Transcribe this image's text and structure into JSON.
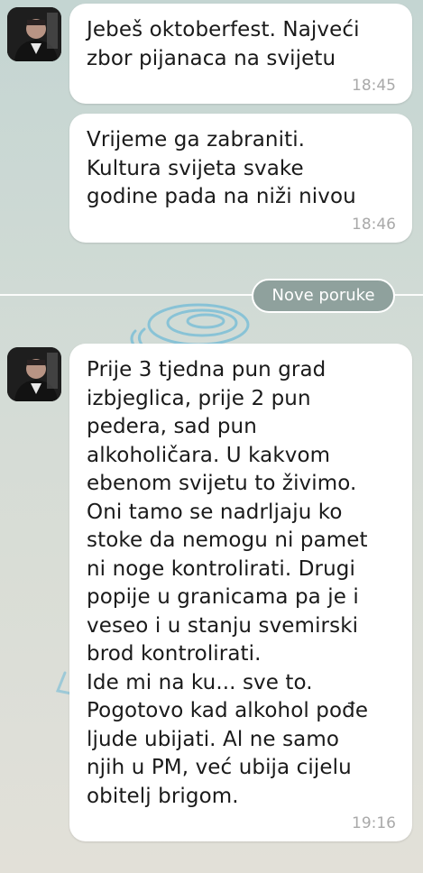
{
  "chat": {
    "messages": [
      {
        "text": "Jebeš oktoberfest. Najveći\nzbor pijanaca na svijetu",
        "time": "18:45"
      },
      {
        "text": "Vrijeme ga zabraniti.\nKultura svijeta svake\ngodine pada na niži nivou",
        "time": "18:46"
      },
      {
        "text": "Prije 3 tjedna pun grad\nizbjeglica, prije 2 pun\npedera, sad pun\nalkoholičara. U kakvom\nebenom svijetu to živimo.\nOni tamo se nadrljaju ko\nstoke da nemogu ni pamet\nni noge kontrolirati. Drugi\npopije u granicama pa je i\nveseo i u stanju svemirski\nbrod kontrolirati.\nIde mi na ku... sve to.\nPogotovo kad alkohol pođe\nljude ubijati. Al ne samo\nnjih u PM, već ubija cijelu\nobitelj brigom.",
        "time": "19:16"
      }
    ],
    "new_messages_label": "Nove poruke"
  },
  "colors": {
    "background": "#cdd9d4",
    "bubble": "#ffffff",
    "timestamp": "#a9a9a9",
    "divider_pill": "#8fa19d",
    "swirl": "#4fb0d8"
  },
  "icons": {
    "avatar": "user-photo",
    "background_pattern": "swirl-doodle"
  }
}
